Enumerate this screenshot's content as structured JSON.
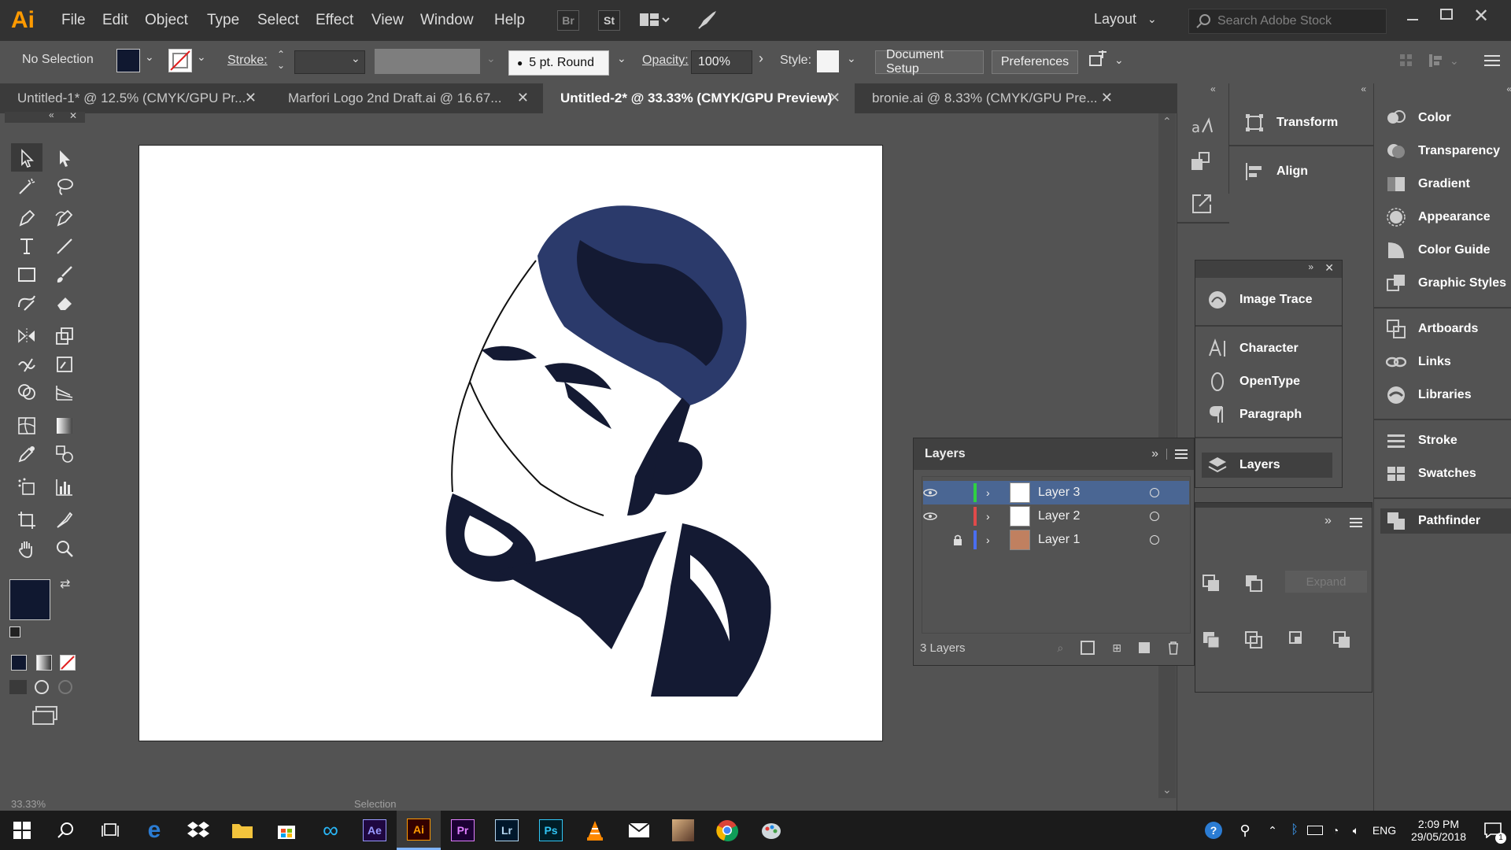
{
  "app": {
    "logo": "Ai",
    "menu": [
      "File",
      "Edit",
      "Object",
      "Type",
      "Select",
      "Effect",
      "View",
      "Window",
      "Help"
    ],
    "bridge_label": "Br",
    "stock_label": "St",
    "workspace": "Layout",
    "search_placeholder": "Search Adobe Stock"
  },
  "control": {
    "selection": "No Selection",
    "stroke_label": "Stroke:",
    "brush": "5 pt. Round",
    "opacity_label": "Opacity:",
    "opacity": "100%",
    "style_label": "Style:",
    "document_setup": "Document Setup",
    "preferences": "Preferences",
    "fill_color": "#101830"
  },
  "tabs": [
    {
      "label": "Untitled-1* @ 12.5% (CMYK/GPU Pr...",
      "active": false
    },
    {
      "label": "Marfori Logo 2nd Draft.ai @ 16.67...",
      "active": false
    },
    {
      "label": "Untitled-2* @ 33.33% (CMYK/GPU Preview)",
      "active": true
    },
    {
      "label": "bronie.ai @ 8.33% (CMYK/GPU Pre...",
      "active": false
    }
  ],
  "panels": {
    "col1": [
      {
        "label": "Transform",
        "icon": "transform-icon"
      },
      {
        "label": "Align",
        "icon": "align-icon"
      }
    ],
    "col1b": [
      {
        "label": "Image Trace",
        "icon": "image-trace-icon"
      },
      {
        "label": "Character",
        "icon": "character-icon"
      },
      {
        "label": "OpenType",
        "icon": "opentype-icon"
      },
      {
        "label": "Paragraph",
        "icon": "paragraph-icon"
      },
      {
        "label": "Layers",
        "icon": "layers-icon"
      }
    ],
    "col2": [
      {
        "label": "Color",
        "icon": "color-icon"
      },
      {
        "label": "Transparency",
        "icon": "transparency-icon"
      },
      {
        "label": "Gradient",
        "icon": "gradient-icon"
      },
      {
        "label": "Appearance",
        "icon": "appearance-icon"
      },
      {
        "label": "Color Guide",
        "icon": "color-guide-icon"
      },
      {
        "label": "Graphic Styles",
        "icon": "graphic-styles-icon"
      },
      {
        "label": "Artboards",
        "icon": "artboards-icon"
      },
      {
        "label": "Links",
        "icon": "links-icon"
      },
      {
        "label": "Libraries",
        "icon": "libraries-icon"
      },
      {
        "label": "Stroke",
        "icon": "stroke-icon"
      },
      {
        "label": "Swatches",
        "icon": "swatches-icon"
      },
      {
        "label": "Pathfinder",
        "icon": "pathfinder-icon"
      }
    ],
    "pathfinder_expand": "Expand"
  },
  "layers_panel": {
    "title": "Layers",
    "layers": [
      {
        "name": "Layer 3",
        "color": "#2fd142",
        "visible": true,
        "locked": false,
        "selected": true
      },
      {
        "name": "Layer 2",
        "color": "#e04a4a",
        "visible": true,
        "locked": false,
        "selected": false
      },
      {
        "name": "Layer 1",
        "color": "#4a6ef0",
        "visible": false,
        "locked": true,
        "selected": false
      }
    ],
    "count": "3 Layers"
  },
  "status": {
    "zoom": "33.33%",
    "mode": "Selection"
  },
  "taskbar": {
    "lang": "ENG",
    "time": "2:09 PM",
    "date": "29/05/2018",
    "notifications": "1",
    "apps": [
      "Ae",
      "Ai",
      "Pr",
      "Lr",
      "Ps"
    ]
  }
}
